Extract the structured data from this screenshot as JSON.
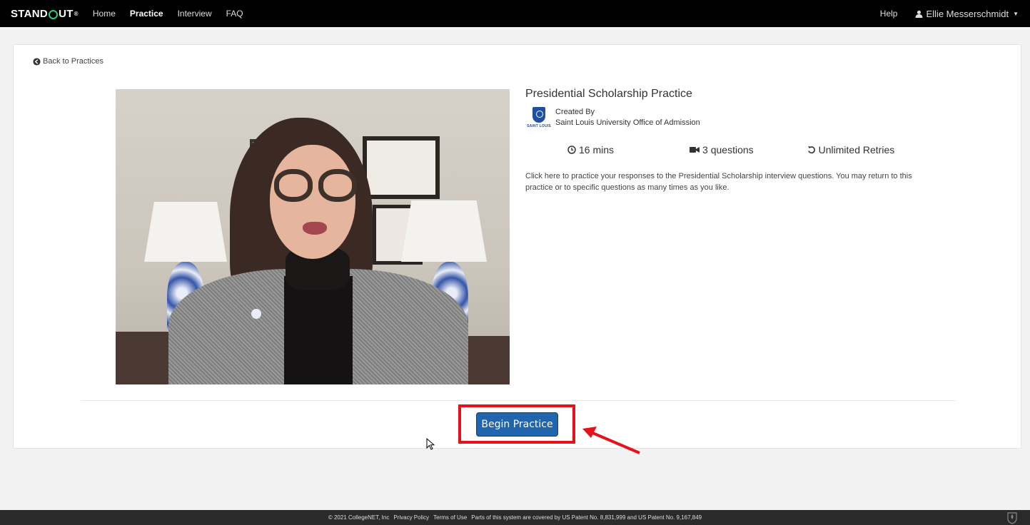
{
  "nav": {
    "brand_pre": "STAND",
    "brand_post": "UT",
    "brand_tm": "®",
    "links": [
      {
        "label": "Home"
      },
      {
        "label": "Practice"
      },
      {
        "label": "Interview"
      },
      {
        "label": "FAQ"
      }
    ],
    "active": "Practice",
    "help": "Help",
    "user_name": "Ellie Messerschmidt"
  },
  "back_link": "Back to Practices",
  "practice": {
    "title": "Presidential Scholarship Practice",
    "created_by_label": "Created By",
    "creator": "Saint Louis University Office of Admission",
    "logo_text": "SAINT LOUIS",
    "duration": "16 mins",
    "questions": "3 questions",
    "retries": "Unlimited Retries",
    "description": "Click here to practice your responses to the Presidential Scholarship interview questions. You may return to this practice or to specific questions as many times as you like."
  },
  "begin_button": "Begin Practice",
  "footer": {
    "copyright": "© 2021 CollegeNET, Inc",
    "privacy": "Privacy Policy",
    "terms": "Terms of Use",
    "patent": "Parts of this system are covered by US Patent No. 8,831,999 and US Patent No. 9,167,849"
  },
  "colors": {
    "navbar": "#000000",
    "brand_accent": "#2ecc71",
    "button": "#2065ad",
    "highlight": "#e5121a"
  }
}
